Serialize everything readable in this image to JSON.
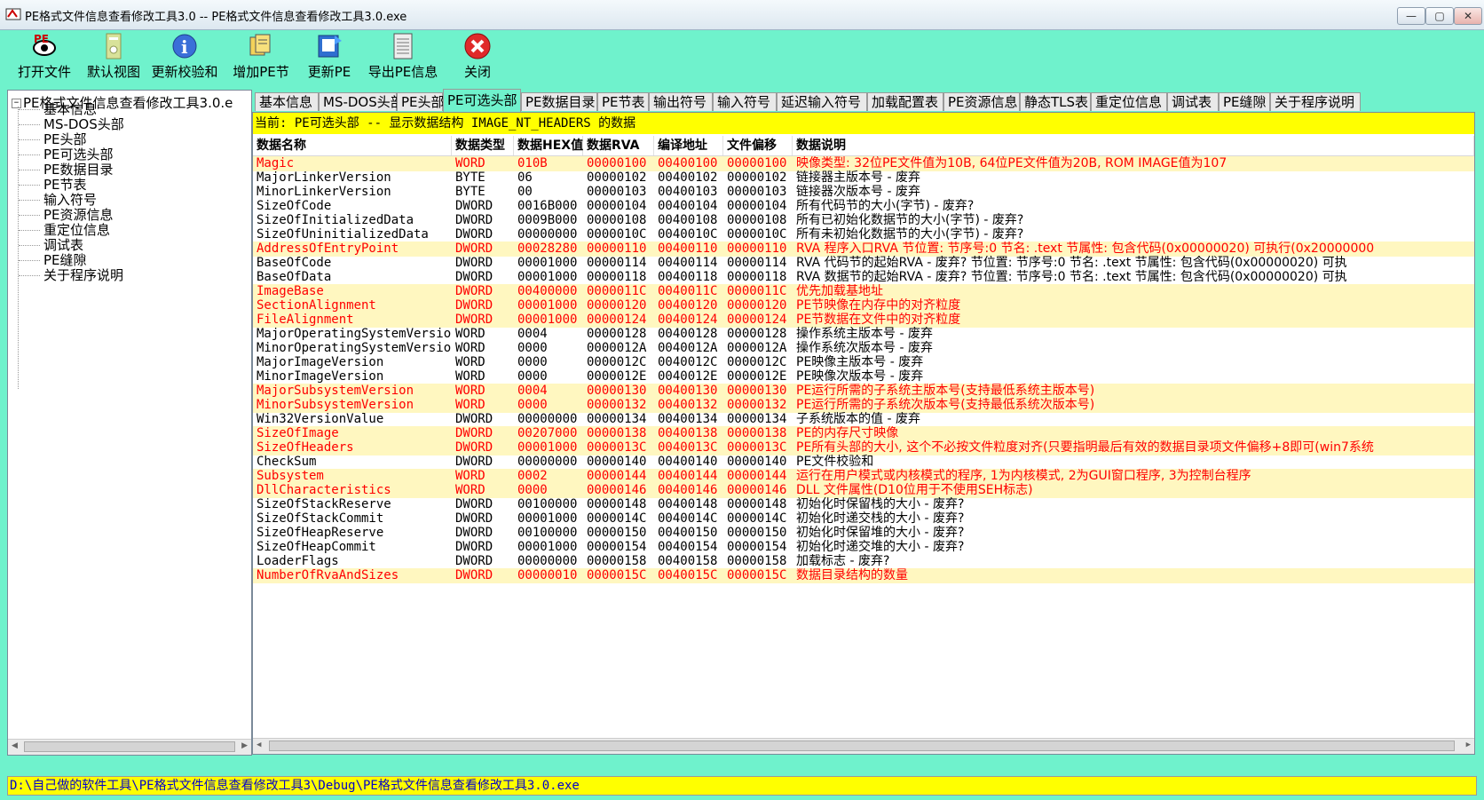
{
  "window": {
    "title": "PE格式文件信息查看修改工具3.0 -- PE格式文件信息查看修改工具3.0.exe",
    "min_glyph": "—",
    "max_glyph": "▢",
    "close_glyph": "✕"
  },
  "toolbar": {
    "buttons": [
      {
        "label": "打开文件",
        "icon": "open-file-icon"
      },
      {
        "label": "默认视图",
        "icon": "default-view-icon"
      },
      {
        "label": "更新校验和",
        "icon": "info-icon"
      },
      {
        "label": "增加PE节",
        "icon": "add-section-icon"
      },
      {
        "label": "更新PE",
        "icon": "update-pe-icon"
      },
      {
        "label": "导出PE信息",
        "icon": "export-icon"
      },
      {
        "label": "关闭",
        "icon": "close-icon"
      }
    ]
  },
  "tree": {
    "root": "PE格式文件信息查看修改工具3.0.e",
    "items": [
      "基本信息",
      "MS-DOS头部",
      "PE头部",
      "PE可选头部",
      "PE数据目录",
      "PE节表",
      "输入符号",
      "PE资源信息",
      "重定位信息",
      "调试表",
      "PE缝隙",
      "关于程序说明"
    ]
  },
  "tabs": [
    "基本信息",
    "MS-DOS头部",
    "PE头部",
    "PE可选头部",
    "PE数据目录",
    "PE节表",
    "输出符号",
    "输入符号",
    "延迟输入符号",
    "加载配置表",
    "PE资源信息",
    "静态TLS表",
    "重定位信息",
    "调试表",
    "PE缝隙",
    "关于程序说明"
  ],
  "active_tab": "PE可选头部",
  "current_label": "当前: PE可选头部 -- 显示数据结构 IMAGE_NT_HEADERS 的数据",
  "table": {
    "headers": [
      "数据名称",
      "数据类型",
      "数据HEX值",
      "数据RVA",
      "编译地址",
      "文件偏移",
      "数据说明"
    ],
    "rows": [
      {
        "name": "Magic",
        "type": "WORD",
        "hex": "010B",
        "rva": "00000100",
        "addr": "00400100",
        "off": "00000100",
        "desc": "映像类型: 32位PE文件值为10B, 64位PE文件值为20B, ROM IMAGE值为107",
        "hl": true
      },
      {
        "name": "MajorLinkerVersion",
        "type": "BYTE",
        "hex": "06",
        "rva": "00000102",
        "addr": "00400102",
        "off": "00000102",
        "desc": "链接器主版本号 - 废弃",
        "hl": false
      },
      {
        "name": "MinorLinkerVersion",
        "type": "BYTE",
        "hex": "00",
        "rva": "00000103",
        "addr": "00400103",
        "off": "00000103",
        "desc": "链接器次版本号 - 废弃",
        "hl": false
      },
      {
        "name": "SizeOfCode",
        "type": "DWORD",
        "hex": "0016B000",
        "rva": "00000104",
        "addr": "00400104",
        "off": "00000104",
        "desc": "所有代码节的大小(字节) - 废弃?",
        "hl": false
      },
      {
        "name": "SizeOfInitializedData",
        "type": "DWORD",
        "hex": "0009B000",
        "rva": "00000108",
        "addr": "00400108",
        "off": "00000108",
        "desc": "所有已初始化数据节的大小(字节) - 废弃?",
        "hl": false
      },
      {
        "name": "SizeOfUninitializedData",
        "type": "DWORD",
        "hex": "00000000",
        "rva": "0000010C",
        "addr": "0040010C",
        "off": "0000010C",
        "desc": "所有未初始化数据节的大小(字节) - 废弃?",
        "hl": false
      },
      {
        "name": "AddressOfEntryPoint",
        "type": "DWORD",
        "hex": "00028280",
        "rva": "00000110",
        "addr": "00400110",
        "off": "00000110",
        "desc": "RVA 程序入口RVA 节位置: 节序号:0  节名: .text 节属性: 包含代码(0x00000020) 可执行(0x20000000",
        "hl": true
      },
      {
        "name": "BaseOfCode",
        "type": "DWORD",
        "hex": "00001000",
        "rva": "00000114",
        "addr": "00400114",
        "off": "00000114",
        "desc": "RVA 代码节的起始RVA - 废弃? 节位置: 节序号:0  节名: .text 节属性: 包含代码(0x00000020) 可执",
        "hl": false
      },
      {
        "name": "BaseOfData",
        "type": "DWORD",
        "hex": "00001000",
        "rva": "00000118",
        "addr": "00400118",
        "off": "00000118",
        "desc": "RVA 数据节的起始RVA - 废弃? 节位置: 节序号:0  节名: .text 节属性: 包含代码(0x00000020) 可执",
        "hl": false
      },
      {
        "name": "ImageBase",
        "type": "DWORD",
        "hex": "00400000",
        "rva": "0000011C",
        "addr": "0040011C",
        "off": "0000011C",
        "desc": "优先加载基地址",
        "hl": true
      },
      {
        "name": "SectionAlignment",
        "type": "DWORD",
        "hex": "00001000",
        "rva": "00000120",
        "addr": "00400120",
        "off": "00000120",
        "desc": "PE节映像在内存中的对齐粒度",
        "hl": true
      },
      {
        "name": "FileAlignment",
        "type": "DWORD",
        "hex": "00001000",
        "rva": "00000124",
        "addr": "00400124",
        "off": "00000124",
        "desc": "PE节数据在文件中的对齐粒度",
        "hl": true
      },
      {
        "name": "MajorOperatingSystemVersion",
        "type": "WORD",
        "hex": "0004",
        "rva": "00000128",
        "addr": "00400128",
        "off": "00000128",
        "desc": "操作系统主版本号 - 废弃",
        "hl": false
      },
      {
        "name": "MinorOperatingSystemVersion",
        "type": "WORD",
        "hex": "0000",
        "rva": "0000012A",
        "addr": "0040012A",
        "off": "0000012A",
        "desc": "操作系统次版本号 - 废弃",
        "hl": false
      },
      {
        "name": "MajorImageVersion",
        "type": "WORD",
        "hex": "0000",
        "rva": "0000012C",
        "addr": "0040012C",
        "off": "0000012C",
        "desc": "PE映像主版本号 - 废弃",
        "hl": false
      },
      {
        "name": "MinorImageVersion",
        "type": "WORD",
        "hex": "0000",
        "rva": "0000012E",
        "addr": "0040012E",
        "off": "0000012E",
        "desc": "PE映像次版本号 - 废弃",
        "hl": false
      },
      {
        "name": "MajorSubsystemVersion",
        "type": "WORD",
        "hex": "0004",
        "rva": "00000130",
        "addr": "00400130",
        "off": "00000130",
        "desc": "PE运行所需的子系统主版本号(支持最低系统主版本号)",
        "hl": true
      },
      {
        "name": "MinorSubsystemVersion",
        "type": "WORD",
        "hex": "0000",
        "rva": "00000132",
        "addr": "00400132",
        "off": "00000132",
        "desc": "PE运行所需的子系统次版本号(支持最低系统次版本号)",
        "hl": true
      },
      {
        "name": "Win32VersionValue",
        "type": "DWORD",
        "hex": "00000000",
        "rva": "00000134",
        "addr": "00400134",
        "off": "00000134",
        "desc": "子系统版本的值 - 废弃",
        "hl": false
      },
      {
        "name": "SizeOfImage",
        "type": "DWORD",
        "hex": "00207000",
        "rva": "00000138",
        "addr": "00400138",
        "off": "00000138",
        "desc": "PE的内存尺寸映像",
        "hl": true
      },
      {
        "name": "SizeOfHeaders",
        "type": "DWORD",
        "hex": "00001000",
        "rva": "0000013C",
        "addr": "0040013C",
        "off": "0000013C",
        "desc": "PE所有头部的大小, 这个不必按文件粒度对齐(只要指明最后有效的数据目录项文件偏移+8即可(win7系统",
        "hl": true
      },
      {
        "name": "CheckSum",
        "type": "DWORD",
        "hex": "00000000",
        "rva": "00000140",
        "addr": "00400140",
        "off": "00000140",
        "desc": "PE文件校验和",
        "hl": false
      },
      {
        "name": "Subsystem",
        "type": "WORD",
        "hex": "0002",
        "rva": "00000144",
        "addr": "00400144",
        "off": "00000144",
        "desc": "运行在用户模式或内核模式的程序, 1为内核模式, 2为GUI窗口程序, 3为控制台程序",
        "hl": true
      },
      {
        "name": "DllCharacteristics",
        "type": "WORD",
        "hex": "0000",
        "rva": "00000146",
        "addr": "00400146",
        "off": "00000146",
        "desc": "DLL 文件属性(D10位用于不使用SEH标志)",
        "hl": true
      },
      {
        "name": "SizeOfStackReserve",
        "type": "DWORD",
        "hex": "00100000",
        "rva": "00000148",
        "addr": "00400148",
        "off": "00000148",
        "desc": "初始化时保留栈的大小 - 废弃?",
        "hl": false
      },
      {
        "name": "SizeOfStackCommit",
        "type": "DWORD",
        "hex": "00001000",
        "rva": "0000014C",
        "addr": "0040014C",
        "off": "0000014C",
        "desc": "初始化时递交栈的大小 - 废弃?",
        "hl": false
      },
      {
        "name": "SizeOfHeapReserve",
        "type": "DWORD",
        "hex": "00100000",
        "rva": "00000150",
        "addr": "00400150",
        "off": "00000150",
        "desc": "初始化时保留堆的大小 - 废弃?",
        "hl": false
      },
      {
        "name": "SizeOfHeapCommit",
        "type": "DWORD",
        "hex": "00001000",
        "rva": "00000154",
        "addr": "00400154",
        "off": "00000154",
        "desc": "初始化时递交堆的大小 - 废弃?",
        "hl": false
      },
      {
        "name": "LoaderFlags",
        "type": "DWORD",
        "hex": "00000000",
        "rva": "00000158",
        "addr": "00400158",
        "off": "00000158",
        "desc": "加载标志 - 废弃?",
        "hl": false
      },
      {
        "name": "NumberOfRvaAndSizes",
        "type": "DWORD",
        "hex": "00000010",
        "rva": "0000015C",
        "addr": "0040015C",
        "off": "0000015C",
        "desc": "数据目录结构的数量",
        "hl": true
      }
    ]
  },
  "status_path": "D:\\自己做的软件工具\\PE格式文件信息查看修改工具3\\Debug\\PE格式文件信息查看修改工具3.0.exe",
  "colors": {
    "background": "#6ff2cc",
    "highlight_text": "#ff0000",
    "current_bar": "#ffff00",
    "status_text": "#0000cc"
  }
}
